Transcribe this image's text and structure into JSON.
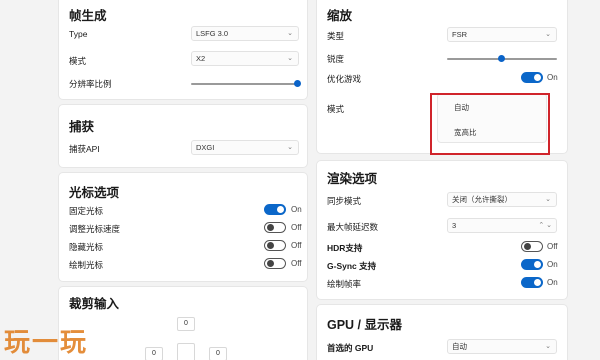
{
  "frame_gen": {
    "title": "帧生成",
    "type_label": "Type",
    "type_value": "LSFG 3.0",
    "mode_label": "模式",
    "mode_value": "X2",
    "resolution_scale_label": "分辨率比例",
    "resolution_scale_value": 1.0
  },
  "capture": {
    "title": "捕获",
    "api_label": "捕获API",
    "api_value": "DXGI"
  },
  "cursor": {
    "title": "光标选项",
    "items": [
      {
        "label": "固定光标",
        "state": "On"
      },
      {
        "label": "调整光标速度",
        "state": "Off"
      },
      {
        "label": "隐藏光标",
        "state": "Off"
      },
      {
        "label": "绘制光标",
        "state": "Off"
      }
    ]
  },
  "crop": {
    "title": "裁剪输入",
    "top": "0",
    "left": "0",
    "right": "0"
  },
  "scaling": {
    "title": "缩放",
    "type_label": "类型",
    "type_value": "FSR",
    "sharpness_label": "锐度",
    "sharpness_value": 0.5,
    "optimize_label": "优化游戏",
    "optimize_state": "On",
    "mode_label": "模式",
    "mode_options": [
      "自动",
      "宽高比"
    ]
  },
  "render": {
    "title": "渲染选项",
    "sync_label": "同步模式",
    "sync_value": "关闭（允许撕裂）",
    "max_latency_label": "最大帧延迟数",
    "max_latency_value": "3",
    "hdr_label": "HDR支持",
    "hdr_state": "Off",
    "gsync_label": "G-Sync 支持",
    "gsync_state": "On",
    "draw_fps_label": "绘制帧率",
    "draw_fps_state": "On"
  },
  "gpu": {
    "title": "GPU / 显示器",
    "preferred_label": "首选的 GPU",
    "preferred_value": "自动"
  },
  "watermark": "玩一玩",
  "colors": {
    "accent": "#0b67c9",
    "highlight": "#d0242b",
    "watermark": "#e07b1a"
  },
  "icons": {
    "dropdown": "chevron-down-icon",
    "stepper": "chevron-up-down-icon"
  }
}
